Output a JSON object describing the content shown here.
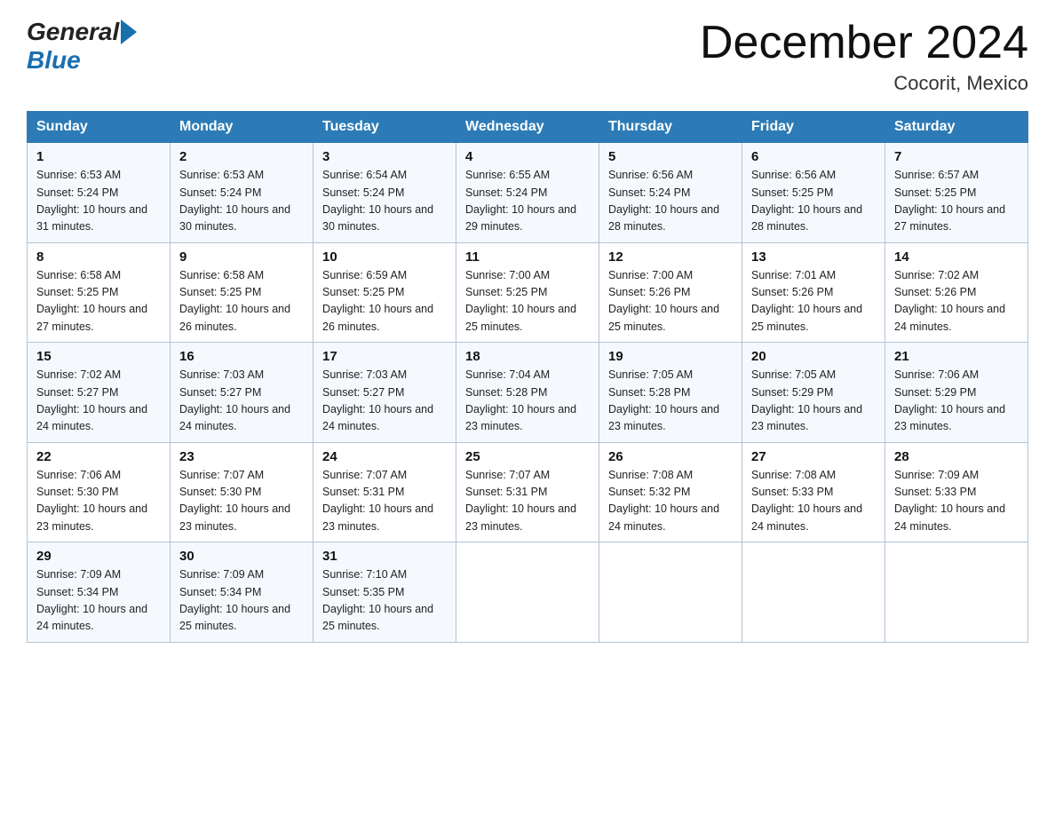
{
  "header": {
    "logo_general": "General",
    "logo_blue": "Blue",
    "month_title": "December 2024",
    "location": "Cocorit, Mexico"
  },
  "weekdays": [
    "Sunday",
    "Monday",
    "Tuesday",
    "Wednesday",
    "Thursday",
    "Friday",
    "Saturday"
  ],
  "weeks": [
    [
      {
        "day": "1",
        "sunrise": "6:53 AM",
        "sunset": "5:24 PM",
        "daylight": "10 hours and 31 minutes."
      },
      {
        "day": "2",
        "sunrise": "6:53 AM",
        "sunset": "5:24 PM",
        "daylight": "10 hours and 30 minutes."
      },
      {
        "day": "3",
        "sunrise": "6:54 AM",
        "sunset": "5:24 PM",
        "daylight": "10 hours and 30 minutes."
      },
      {
        "day": "4",
        "sunrise": "6:55 AM",
        "sunset": "5:24 PM",
        "daylight": "10 hours and 29 minutes."
      },
      {
        "day": "5",
        "sunrise": "6:56 AM",
        "sunset": "5:24 PM",
        "daylight": "10 hours and 28 minutes."
      },
      {
        "day": "6",
        "sunrise": "6:56 AM",
        "sunset": "5:25 PM",
        "daylight": "10 hours and 28 minutes."
      },
      {
        "day": "7",
        "sunrise": "6:57 AM",
        "sunset": "5:25 PM",
        "daylight": "10 hours and 27 minutes."
      }
    ],
    [
      {
        "day": "8",
        "sunrise": "6:58 AM",
        "sunset": "5:25 PM",
        "daylight": "10 hours and 27 minutes."
      },
      {
        "day": "9",
        "sunrise": "6:58 AM",
        "sunset": "5:25 PM",
        "daylight": "10 hours and 26 minutes."
      },
      {
        "day": "10",
        "sunrise": "6:59 AM",
        "sunset": "5:25 PM",
        "daylight": "10 hours and 26 minutes."
      },
      {
        "day": "11",
        "sunrise": "7:00 AM",
        "sunset": "5:25 PM",
        "daylight": "10 hours and 25 minutes."
      },
      {
        "day": "12",
        "sunrise": "7:00 AM",
        "sunset": "5:26 PM",
        "daylight": "10 hours and 25 minutes."
      },
      {
        "day": "13",
        "sunrise": "7:01 AM",
        "sunset": "5:26 PM",
        "daylight": "10 hours and 25 minutes."
      },
      {
        "day": "14",
        "sunrise": "7:02 AM",
        "sunset": "5:26 PM",
        "daylight": "10 hours and 24 minutes."
      }
    ],
    [
      {
        "day": "15",
        "sunrise": "7:02 AM",
        "sunset": "5:27 PM",
        "daylight": "10 hours and 24 minutes."
      },
      {
        "day": "16",
        "sunrise": "7:03 AM",
        "sunset": "5:27 PM",
        "daylight": "10 hours and 24 minutes."
      },
      {
        "day": "17",
        "sunrise": "7:03 AM",
        "sunset": "5:27 PM",
        "daylight": "10 hours and 24 minutes."
      },
      {
        "day": "18",
        "sunrise": "7:04 AM",
        "sunset": "5:28 PM",
        "daylight": "10 hours and 23 minutes."
      },
      {
        "day": "19",
        "sunrise": "7:05 AM",
        "sunset": "5:28 PM",
        "daylight": "10 hours and 23 minutes."
      },
      {
        "day": "20",
        "sunrise": "7:05 AM",
        "sunset": "5:29 PM",
        "daylight": "10 hours and 23 minutes."
      },
      {
        "day": "21",
        "sunrise": "7:06 AM",
        "sunset": "5:29 PM",
        "daylight": "10 hours and 23 minutes."
      }
    ],
    [
      {
        "day": "22",
        "sunrise": "7:06 AM",
        "sunset": "5:30 PM",
        "daylight": "10 hours and 23 minutes."
      },
      {
        "day": "23",
        "sunrise": "7:07 AM",
        "sunset": "5:30 PM",
        "daylight": "10 hours and 23 minutes."
      },
      {
        "day": "24",
        "sunrise": "7:07 AM",
        "sunset": "5:31 PM",
        "daylight": "10 hours and 23 minutes."
      },
      {
        "day": "25",
        "sunrise": "7:07 AM",
        "sunset": "5:31 PM",
        "daylight": "10 hours and 23 minutes."
      },
      {
        "day": "26",
        "sunrise": "7:08 AM",
        "sunset": "5:32 PM",
        "daylight": "10 hours and 24 minutes."
      },
      {
        "day": "27",
        "sunrise": "7:08 AM",
        "sunset": "5:33 PM",
        "daylight": "10 hours and 24 minutes."
      },
      {
        "day": "28",
        "sunrise": "7:09 AM",
        "sunset": "5:33 PM",
        "daylight": "10 hours and 24 minutes."
      }
    ],
    [
      {
        "day": "29",
        "sunrise": "7:09 AM",
        "sunset": "5:34 PM",
        "daylight": "10 hours and 24 minutes."
      },
      {
        "day": "30",
        "sunrise": "7:09 AM",
        "sunset": "5:34 PM",
        "daylight": "10 hours and 25 minutes."
      },
      {
        "day": "31",
        "sunrise": "7:10 AM",
        "sunset": "5:35 PM",
        "daylight": "10 hours and 25 minutes."
      },
      null,
      null,
      null,
      null
    ]
  ]
}
